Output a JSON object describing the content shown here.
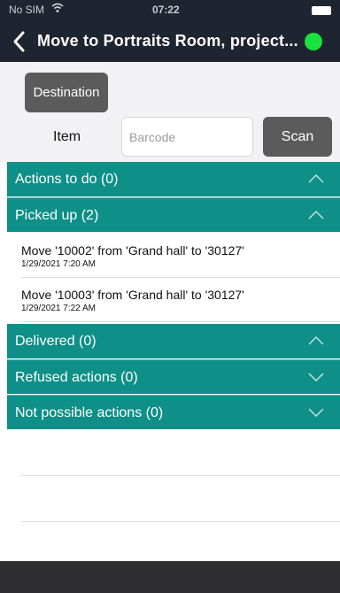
{
  "status_bar": {
    "carrier": "No SIM",
    "time": "07:22"
  },
  "nav": {
    "title": "Move to Portraits Room, project..."
  },
  "scan": {
    "destination_label": "Destination",
    "item_label": "Item",
    "barcode_placeholder": "Barcode",
    "barcode_value": "",
    "scan_label": "Scan"
  },
  "sections": [
    {
      "label": "Actions to do (0)",
      "expanded": true
    },
    {
      "label": "Picked up (2)",
      "expanded": true
    },
    {
      "label": "Delivered (0)",
      "expanded": true
    },
    {
      "label": "Refused actions (0)",
      "expanded": false
    },
    {
      "label": "Not possible actions (0)",
      "expanded": false
    }
  ],
  "picked_up_items": [
    {
      "title": "Move '10002' from 'Grand hall' to '30127'",
      "timestamp": "1/29/2021 7:20 AM"
    },
    {
      "title": "Move '10003' from 'Grand hall' to '30127'",
      "timestamp": "1/29/2021 7:22 AM"
    }
  ],
  "colors": {
    "section_bg": "#0e8f87",
    "nav_bg": "#1f2530",
    "status_ok": "#18e23b",
    "button_bg": "#5b5b5b"
  }
}
